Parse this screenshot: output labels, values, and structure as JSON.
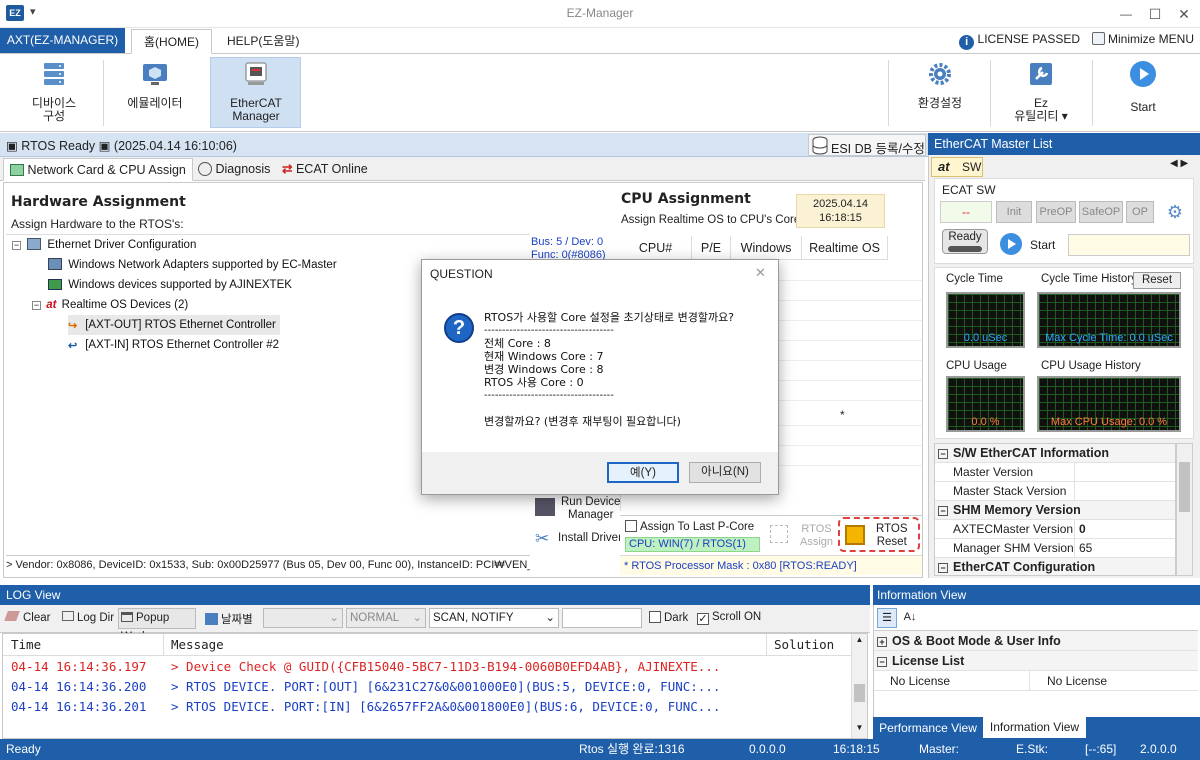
{
  "window": {
    "icon_label": "EZ",
    "title": "EZ-Manager",
    "qat_glyph": "▾",
    "min": "—",
    "max": "☐",
    "close": "✕"
  },
  "ribbon_tabs": {
    "app": "AXT(EZ-MANAGER)",
    "home": "홈(HOME)",
    "help": "HELP(도움말)"
  },
  "top_right": {
    "license": "LICENSE PASSED",
    "minimize_menu": "Minimize MENU"
  },
  "ribbon": {
    "device_config": [
      "디바이스",
      "구성"
    ],
    "emulator": "에뮬레이터",
    "ethercat_manager": [
      "EtherCAT",
      "Manager"
    ],
    "settings": "환경설정",
    "ez_utility": [
      "Ez",
      "유틸리티 ▾"
    ],
    "start": "Start"
  },
  "rtos_bar": {
    "status": "▣ RTOS Ready ▣ (2025.04.14 16:10:06)",
    "esi_db": "ESI DB 등록/수정"
  },
  "subtabs": {
    "network": "Network Card & CPU Assign",
    "diagnosis": "Diagnosis",
    "ecat_online": "ECAT Online"
  },
  "hardware": {
    "title": "Hardware Assignment",
    "subtitle": "Assign Hardware to the RTOS's:",
    "tree": [
      "Ethernet Driver Configuration",
      "Windows Network Adapters supported by EC-Master",
      "Windows devices supported by AJINEXTEK",
      "Realtime OS Devices (2)",
      "[AXT-OUT] RTOS Ethernet Controller",
      "[AXT-IN] RTOS Ethernet Controller #2"
    ],
    "bus_info": [
      "Bus: 5 / Dev: 0",
      "Func: 0(#8086)"
    ],
    "vendor_line": "> Vendor: 0x8086, DeviceID: 0x1533, Sub: 0x00D25977 (Bus 05, Dev 00, Func 00), InstanceID: PCI₩VEN_",
    "run_device_manager": [
      "Run Device",
      "Manager"
    ],
    "install_driver": "Install Driver"
  },
  "cpu": {
    "title": "CPU Assignment",
    "subtitle": "Assign Realtime OS to CPU's Core:",
    "date": "2025.04.14",
    "time": "16:18:15",
    "headers": [
      "CPU#",
      "P/E",
      "Windows",
      "Realtime OS"
    ],
    "star": "*",
    "assign_last": "Assign To Last P-Core",
    "cpu_status": "CPU: WIN(7) / RTOS(1)",
    "rtos_assign": [
      "RTOS",
      "Assign"
    ],
    "rtos_reset": [
      "RTOS",
      "Reset"
    ],
    "mask": "* RTOS Processor Mask : 0x80 [RTOS:READY]"
  },
  "right_panel": {
    "title": "EtherCAT Master List",
    "tab_at": "at",
    "tab_sw": "SW",
    "ecat_sw": "ECAT SW",
    "state_value": "--",
    "states": [
      "Init",
      "PreOP",
      "SafeOP",
      "OP"
    ],
    "ready": "Ready",
    "start": "Start",
    "cycle_time": "Cycle Time",
    "cycle_time_value": "0.0 uSec",
    "cycle_history": "Cycle Time History",
    "reset": "Reset",
    "max_cycle": "Max Cycle Time: 0.0 uSec",
    "cpu_usage": "CPU Usage",
    "cpu_usage_value": "0.0 %",
    "cpu_history": "CPU Usage History",
    "max_cpu": "Max CPU Usage: 0.0 %",
    "props": {
      "g1": "S/W EtherCAT Information",
      "master_version": "Master Version",
      "master_stack_version": "Master Stack Version",
      "g2": "SHM Memory Version",
      "axtec_version": "AXTECMaster Version",
      "axtec_value": "0",
      "manager_shm": "Manager SHM Version",
      "manager_shm_value": "65",
      "g3": "EtherCAT Configuration"
    }
  },
  "log": {
    "title": "LOG View",
    "clear": "Clear",
    "log_dir": "Log Dir",
    "popup": "Popup Wnd",
    "by_date": "날짜별",
    "level": "NORMAL",
    "filter": "SCAN, NOTIFY",
    "dark": "Dark",
    "scroll_on": "Scroll ON",
    "headers": {
      "time": "Time",
      "message": "Message",
      "solution": "Solution"
    },
    "rows": [
      {
        "time": "04-14 16:14:36.197",
        "message": "> Device Check @ GUID({CFB15040-5BC7-11D3-B194-0060B0EFD4AB}, AJINEXTE...",
        "color": "#d22"
      },
      {
        "time": "04-14 16:14:36.200",
        "message": "> RTOS DEVICE. PORT:[OUT] [6&231C27&0&001000E0](BUS:5, DEVICE:0, FUNC:...",
        "color": "#1a3fc4"
      },
      {
        "time": "04-14 16:14:36.201",
        "message": "> RTOS DEVICE. PORT:[IN] [6&2657FF2A&0&001800E0](BUS:6, DEVICE:0, FUNC...",
        "color": "#1a3fc4"
      }
    ]
  },
  "info": {
    "title": "Information View",
    "os_boot": "OS & Boot Mode & User Info",
    "license_list": "License List",
    "no_license_1": "No License",
    "no_license_2": "No License",
    "tab_performance": "Performance View",
    "tab_information": "Information View"
  },
  "status": {
    "ready": "Ready",
    "rtos_done": "Rtos 실행 완료:1316",
    "ip": "0.0.0.0",
    "time": "16:18:15",
    "master": "Master:",
    "estk": "E.Stk:",
    "range": "[--:65]",
    "version": "2.0.0.0"
  },
  "dialog": {
    "title": "QUESTION",
    "question": "RTOS가 사용할 Core 설정을 초기상태로 변경할까요?",
    "separator": "------------------------------------",
    "lines": [
      "전체 Core : 8",
      "현재 Windows Core : 7",
      "변경 Windows Core : 8",
      "RTOS 사용 Core : 0"
    ],
    "confirm": "변경할까요? (변경후 재부팅이 필요합니다)",
    "yes": "예(Y)",
    "no": "아니요(N)",
    "close": "✕"
  }
}
